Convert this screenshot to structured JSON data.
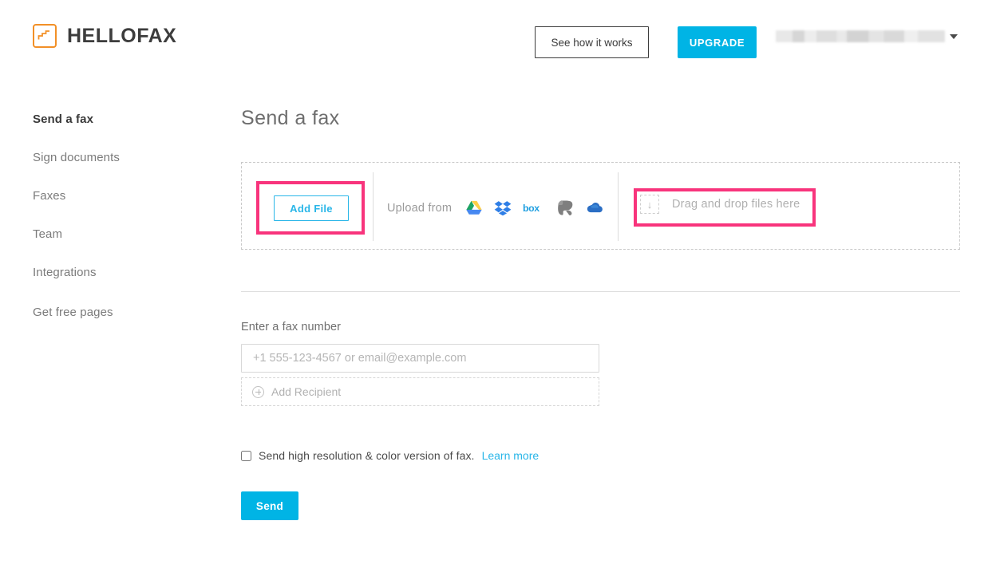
{
  "header": {
    "logo_text": "HELLOFAX",
    "logo_icon": "hellofax-document-pen-icon",
    "logo_color": "#F29027",
    "see_how_label": "See how it works",
    "upgrade_label": "UPGRADE",
    "upgrade_color": "#00b4e5",
    "account_name": "",
    "account_caret_icon": "chevron-down-icon"
  },
  "sidebar": {
    "items": [
      {
        "label": "Send a fax",
        "active": true
      },
      {
        "label": "Sign documents",
        "active": false
      },
      {
        "label": "Faxes",
        "active": false
      },
      {
        "label": "Team",
        "active": false
      },
      {
        "label": "Integrations",
        "active": false
      },
      {
        "label": "Get free pages",
        "active": false
      }
    ]
  },
  "main": {
    "page_title": "Send a fax",
    "upload": {
      "add_file_label": "Add File",
      "upload_from_label": "Upload from",
      "cloud_services": [
        {
          "name": "google-drive-icon",
          "label": "Google Drive"
        },
        {
          "name": "dropbox-icon",
          "label": "Dropbox"
        },
        {
          "name": "box-icon",
          "label": "Box"
        },
        {
          "name": "evernote-icon",
          "label": "Evernote"
        },
        {
          "name": "onedrive-icon",
          "label": "OneDrive"
        }
      ],
      "drop_label": "Drag and drop files here",
      "drop_arrow_icon": "arrow-down-icon",
      "highlight_color": "#f8347c"
    },
    "form": {
      "fax_number_label": "Enter a fax number",
      "fax_number_value": "",
      "fax_number_placeholder": "+1 555-123-4567 or email@example.com",
      "add_recipient_label": "Add Recipient",
      "add_recipient_icon": "plus-circle-icon",
      "hires_checkbox_label": "Send high resolution & color version of fax.",
      "hires_checkbox_checked": false,
      "learn_more_label": "Learn more",
      "send_label": "Send"
    }
  }
}
